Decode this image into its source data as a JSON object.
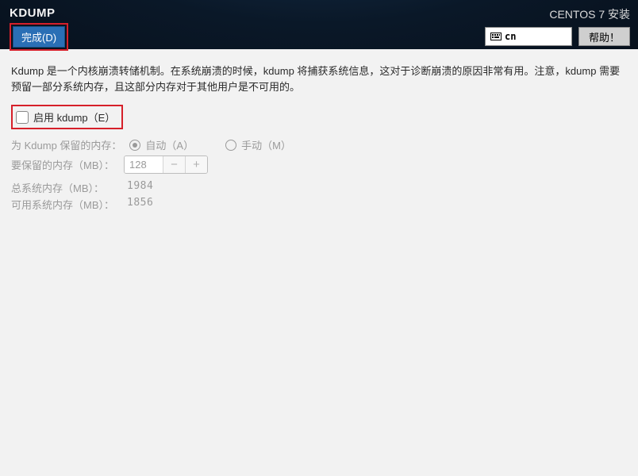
{
  "header": {
    "title": "KDUMP",
    "done_label": "完成(D)",
    "install_label": "CENTOS 7 安装",
    "lang_code": "cn",
    "help_label": "帮助！"
  },
  "content": {
    "description": "Kdump 是一个内核崩溃转储机制。在系统崩溃的时候，kdump 将捕获系统信息，这对于诊断崩溃的原因非常有用。注意，kdump 需要预留一部分系统内存，且这部分内存对于其他用户是不可用的。",
    "enable_label": "启用 kdump（E）",
    "reserve": {
      "label": "为 Kdump 保留的内存：",
      "auto_label": "自动（A）",
      "manual_label": "手动（M）",
      "selected": "auto"
    },
    "to_reserve": {
      "label": "要保留的内存（MB）：",
      "value": "128"
    },
    "total_mem": {
      "label": "总系统内存（MB）：",
      "value": "1984"
    },
    "avail_mem": {
      "label": "可用系统内存（MB）：",
      "value": "1856"
    }
  }
}
